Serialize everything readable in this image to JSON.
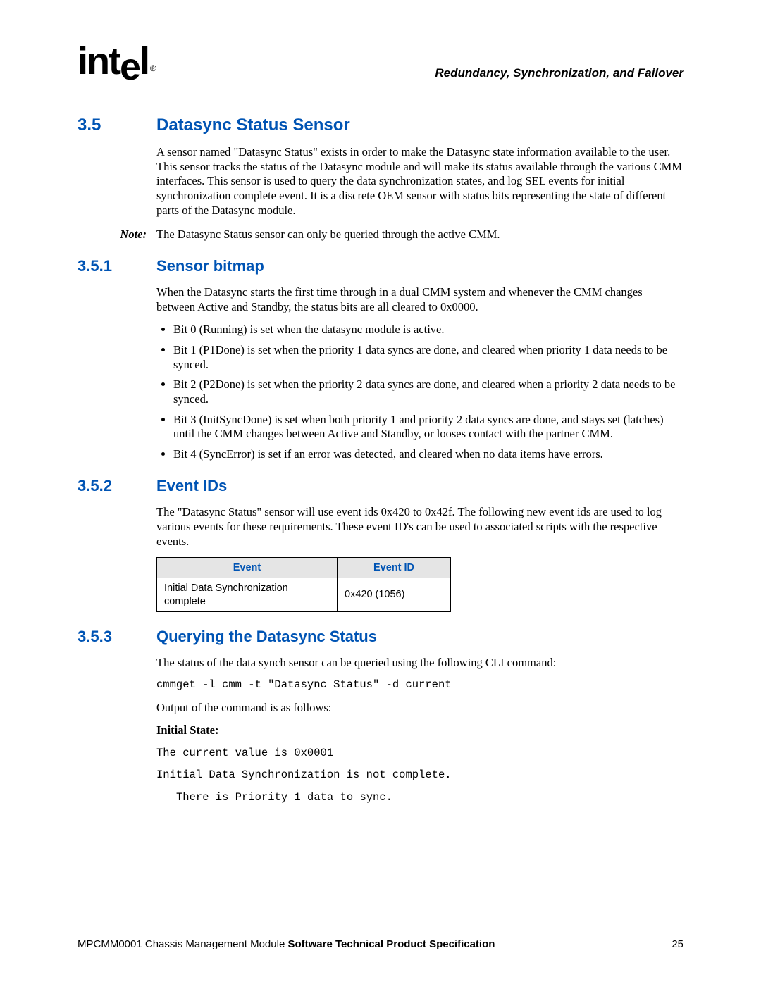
{
  "header": {
    "logo_text": "intel",
    "logo_reg": "®",
    "chapter_title": "Redundancy, Synchronization, and Failover"
  },
  "sections": {
    "s35": {
      "num": "3.5",
      "title": "Datasync Status Sensor",
      "para1": "A sensor named \"Datasync Status\" exists in order to make the Datasync state information available to the user. This sensor tracks the status of the Datasync module and will make its status available through the various CMM interfaces. This sensor is used to query the data synchronization states, and log SEL events for initial synchronization complete event. It is a discrete OEM sensor with status bits representing the state of different parts of the Datasync module.",
      "note_label": "Note:",
      "note_text": "The Datasync Status sensor can only be queried through the active CMM."
    },
    "s351": {
      "num": "3.5.1",
      "title": "Sensor bitmap",
      "para1": "When the Datasync starts the first time through in a dual CMM system and whenever the CMM changes between Active and Standby, the status bits are all cleared to 0x0000.",
      "bullets": [
        "Bit 0 (Running) is set when the datasync module is active.",
        "Bit 1 (P1Done) is set when the priority 1 data syncs are done, and cleared when priority 1 data needs to be synced.",
        "Bit 2 (P2Done) is set when the priority 2 data syncs are done, and cleared when a priority 2 data needs to be synced.",
        "Bit 3 (InitSyncDone) is set when both priority 1 and priority 2 data syncs are done, and stays set (latches) until the CMM changes between Active and Standby, or looses contact with the partner CMM.",
        "Bit 4 (SyncError) is set if an error was detected, and cleared when no data items have errors."
      ]
    },
    "s352": {
      "num": "3.5.2",
      "title": "Event IDs",
      "para1": "The \"Datasync Status\" sensor will use event ids 0x420 to 0x42f. The following new event ids are used to log various events for these requirements. These event ID's can be used to associated scripts with the respective events.",
      "table": {
        "headers": [
          "Event",
          "Event ID"
        ],
        "rows": [
          [
            "Initial Data Synchronization complete",
            "0x420 (1056)"
          ]
        ]
      }
    },
    "s353": {
      "num": "3.5.3",
      "title": "Querying the Datasync Status",
      "para1": "The status of the data synch sensor can be queried using the following CLI command:",
      "code1": "cmmget -l cmm -t \"Datasync Status\" -d current",
      "para2": "Output of the command is as follows:",
      "subhead": "Initial State:",
      "code2": "The current value is 0x0001",
      "code3": "Initial Data Synchronization is not complete.",
      "code4": "There is Priority 1 data to sync."
    }
  },
  "footer": {
    "doc_prefix": "MPCMM0001 Chassis Management Module ",
    "doc_bold": "Software Technical Product Specification",
    "page_number": "25"
  }
}
